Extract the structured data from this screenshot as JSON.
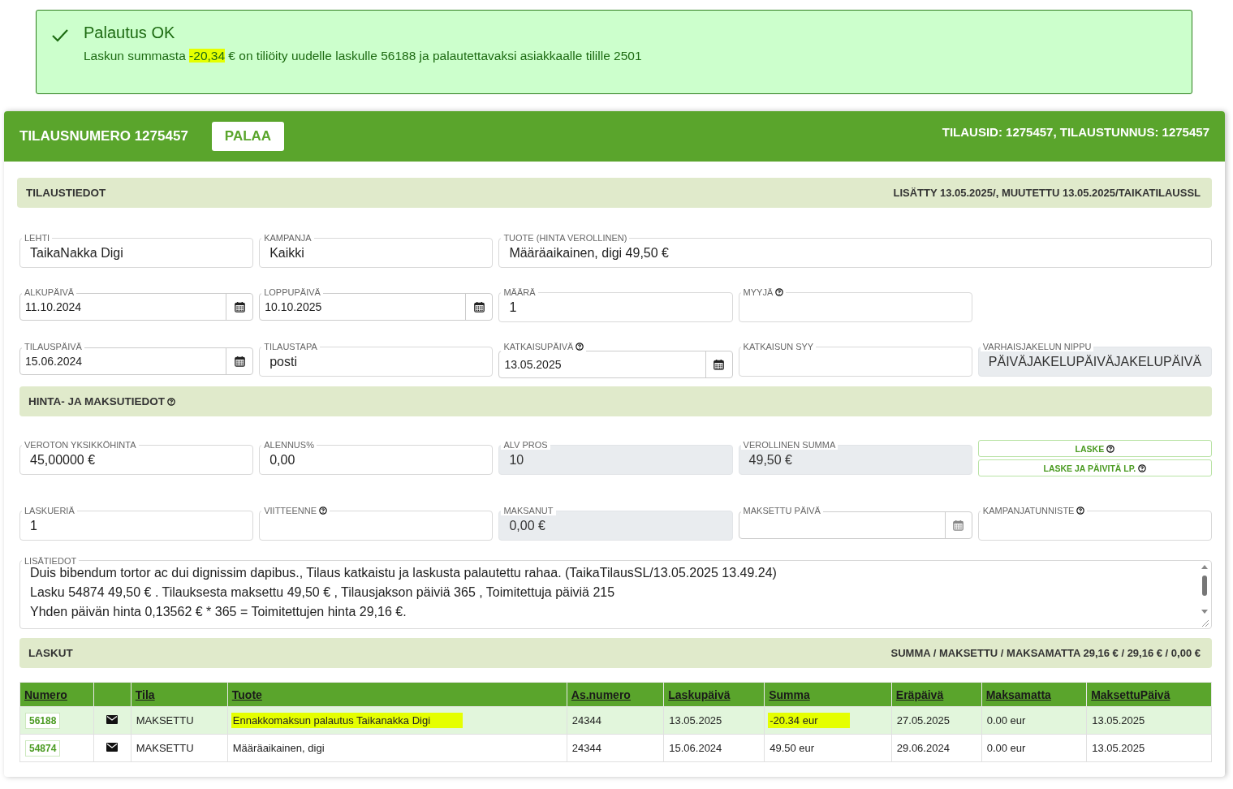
{
  "alert": {
    "title": "Palautus OK",
    "message": [
      {
        "text": "Laskun summasta ",
        "highlighted": false
      },
      {
        "text": "-20,34",
        "highlighted": true
      },
      {
        "text": " € on tiliöity uudelle laskulle 56188 ja palautettavaksi asiakkaalle tilille 2501",
        "highlighted": false
      }
    ]
  },
  "header": {
    "title": "TILAUSNUMERO 1275457",
    "back_button": "PALAA",
    "ids": "TILAUSID: 1275457, TILAUSTUNNUS: 1275457"
  },
  "order_section": {
    "title": "TILAUSTIEDOT",
    "help": false,
    "info": "LISÄTTY 13.05.2025/, MUUTETTU 13.05.2025/TAIKATILAUSSL"
  },
  "order_rows": [
    [
      {
        "kind": "text",
        "label": "LEHTI",
        "value": "TaikaNakka Digi",
        "help": false,
        "disabled": false,
        "wide": false
      },
      {
        "kind": "text",
        "label": "KAMPANJA",
        "value": "Kaikki",
        "help": false,
        "disabled": false,
        "wide": false
      },
      {
        "kind": "text",
        "label": "TUOTE (HINTA VEROLLINEN)",
        "value": "Määräaikainen, digi 49,50 €",
        "help": false,
        "disabled": false,
        "wide": true
      }
    ],
    [
      {
        "kind": "date",
        "label": "ALKUPÄIVÄ",
        "value": "11.10.2024",
        "help": false,
        "disabled": false,
        "wide": false
      },
      {
        "kind": "date",
        "label": "LOPPUPÄIVÄ",
        "value": "10.10.2025",
        "help": false,
        "disabled": false,
        "wide": false
      },
      {
        "kind": "text",
        "label": "MÄÄRÄ",
        "value": "1",
        "help": false,
        "disabled": false,
        "wide": false
      },
      {
        "kind": "text",
        "label": "MYYJÄ",
        "help": true,
        "disabled": false,
        "wide": false
      }
    ],
    [
      {
        "kind": "date",
        "label": "TILAUSPÄIVÄ",
        "value": "15.06.2024",
        "help": false,
        "disabled": false,
        "wide": false
      },
      {
        "kind": "text",
        "label": "TILAUSTAPA",
        "value": "posti",
        "help": false,
        "disabled": false,
        "wide": false
      },
      {
        "kind": "date",
        "label": "KATKAISUPÄIVÄ",
        "value": "13.05.2025",
        "help": true,
        "disabled": false,
        "wide": false
      },
      {
        "kind": "text",
        "label": "KATKAISUN SYY",
        "help": false,
        "disabled": false,
        "wide": false
      },
      {
        "kind": "text",
        "label": "VARHAISJAKELUN NIPPU",
        "value": "PÄIVÄJAKELUPÄIVÄJAKELUPÄIVÄ",
        "help": false,
        "disabled": true,
        "wide": false
      }
    ]
  ],
  "price_section": {
    "title": "HINTA- JA MAKSUTIEDOT",
    "help": true
  },
  "price_rows": [
    [
      {
        "kind": "text",
        "label": "VEROTON YKSIKKÖHINTA",
        "value": "45,00000 €",
        "help": false,
        "disabled": false,
        "wide": false
      },
      {
        "kind": "text",
        "label": "ALENNUS%",
        "value": "0,00",
        "help": false,
        "disabled": false,
        "wide": false
      },
      {
        "kind": "text",
        "label": "ALV PROS",
        "value": "10",
        "help": false,
        "disabled": true,
        "wide": false
      },
      {
        "kind": "text",
        "label": "VEROLLINEN SUMMA",
        "value": "49,50 €",
        "help": false,
        "disabled": true,
        "wide": false
      },
      {
        "kind": "buttons",
        "buttons": [
          {
            "label": "LASKE",
            "help": true
          },
          {
            "label": "LASKE JA PÄIVITÄ LP.",
            "help": true
          }
        ]
      }
    ],
    [
      {
        "kind": "text",
        "label": "LASKUERIÄ",
        "value": "1",
        "help": false,
        "disabled": false,
        "wide": false
      },
      {
        "kind": "text",
        "label": "VIITTEENNE",
        "help": true,
        "disabled": false,
        "wide": false
      },
      {
        "kind": "text",
        "label": "MAKSANUT",
        "value": "0,00 €",
        "help": false,
        "disabled": true,
        "wide": false
      },
      {
        "kind": "date",
        "label": "MAKSETTU PÄIVÄ",
        "help": false,
        "disabled": false,
        "wide": false
      },
      {
        "kind": "text",
        "label": "KAMPANJATUNNISTE",
        "help": true,
        "disabled": false,
        "wide": false
      }
    ]
  ],
  "notes": {
    "label": "LISÄTIEDOT",
    "lines": [
      "Duis bibendum tortor ac dui dignissim dapibus., Tilaus katkaistu ja laskusta palautettu rahaa. (TaikaTilausSL/13.05.2025 13.49.24)",
      "Lasku 54874 49,50 € . Tilauksesta maksettu 49,50 € , Tilausjakson päiviä 365 , Toimitettuja päiviä 215",
      "Yhden päivän hinta 0,13562 € * 365 = Toimitettujen hinta 29,16 €."
    ]
  },
  "invoices_section": {
    "title": "LASKUT",
    "help": false,
    "info": "SUMMA / MAKSETTU / MAKSAMATTA 29,16 € / 29,16 € / 0,00 €"
  },
  "table": {
    "columns": [
      "Numero",
      "",
      "Tila",
      "Tuote",
      "As.numero",
      "Laskupäivä",
      "Summa",
      "Eräpäivä",
      "Maksamatta",
      "MaksettuPäivä"
    ],
    "rows": [
      {
        "selected": true,
        "cells": [
          {
            "kind": "link",
            "text": "56188"
          },
          {
            "kind": "icon"
          },
          {
            "kind": "text",
            "text": "MAKSETTU",
            "highlighted": false
          },
          {
            "kind": "text",
            "text": "Ennakkomaksun palautus Taikanakka Digi",
            "highlighted": true
          },
          {
            "kind": "text",
            "text": "24344",
            "highlighted": false
          },
          {
            "kind": "text",
            "text": "13.05.2025",
            "highlighted": false
          },
          {
            "kind": "text",
            "text": "-20.34 eur",
            "highlighted": true
          },
          {
            "kind": "text",
            "text": "27.05.2025",
            "highlighted": false
          },
          {
            "kind": "text",
            "text": "0.00 eur",
            "highlighted": false
          },
          {
            "kind": "text",
            "text": "13.05.2025",
            "highlighted": false
          }
        ]
      },
      {
        "selected": false,
        "cells": [
          {
            "kind": "link",
            "text": "54874"
          },
          {
            "kind": "icon"
          },
          {
            "kind": "text",
            "text": "MAKSETTU",
            "highlighted": false
          },
          {
            "kind": "text",
            "text": "Määräaikainen, digi",
            "highlighted": false
          },
          {
            "kind": "text",
            "text": "24344",
            "highlighted": false
          },
          {
            "kind": "text",
            "text": "15.06.2024",
            "highlighted": false
          },
          {
            "kind": "text",
            "text": "49.50 eur",
            "highlighted": false
          },
          {
            "kind": "text",
            "text": "29.06.2024",
            "highlighted": false
          },
          {
            "kind": "text",
            "text": "0.00 eur",
            "highlighted": false
          },
          {
            "kind": "text",
            "text": "13.05.2025",
            "highlighted": false
          }
        ]
      }
    ]
  }
}
